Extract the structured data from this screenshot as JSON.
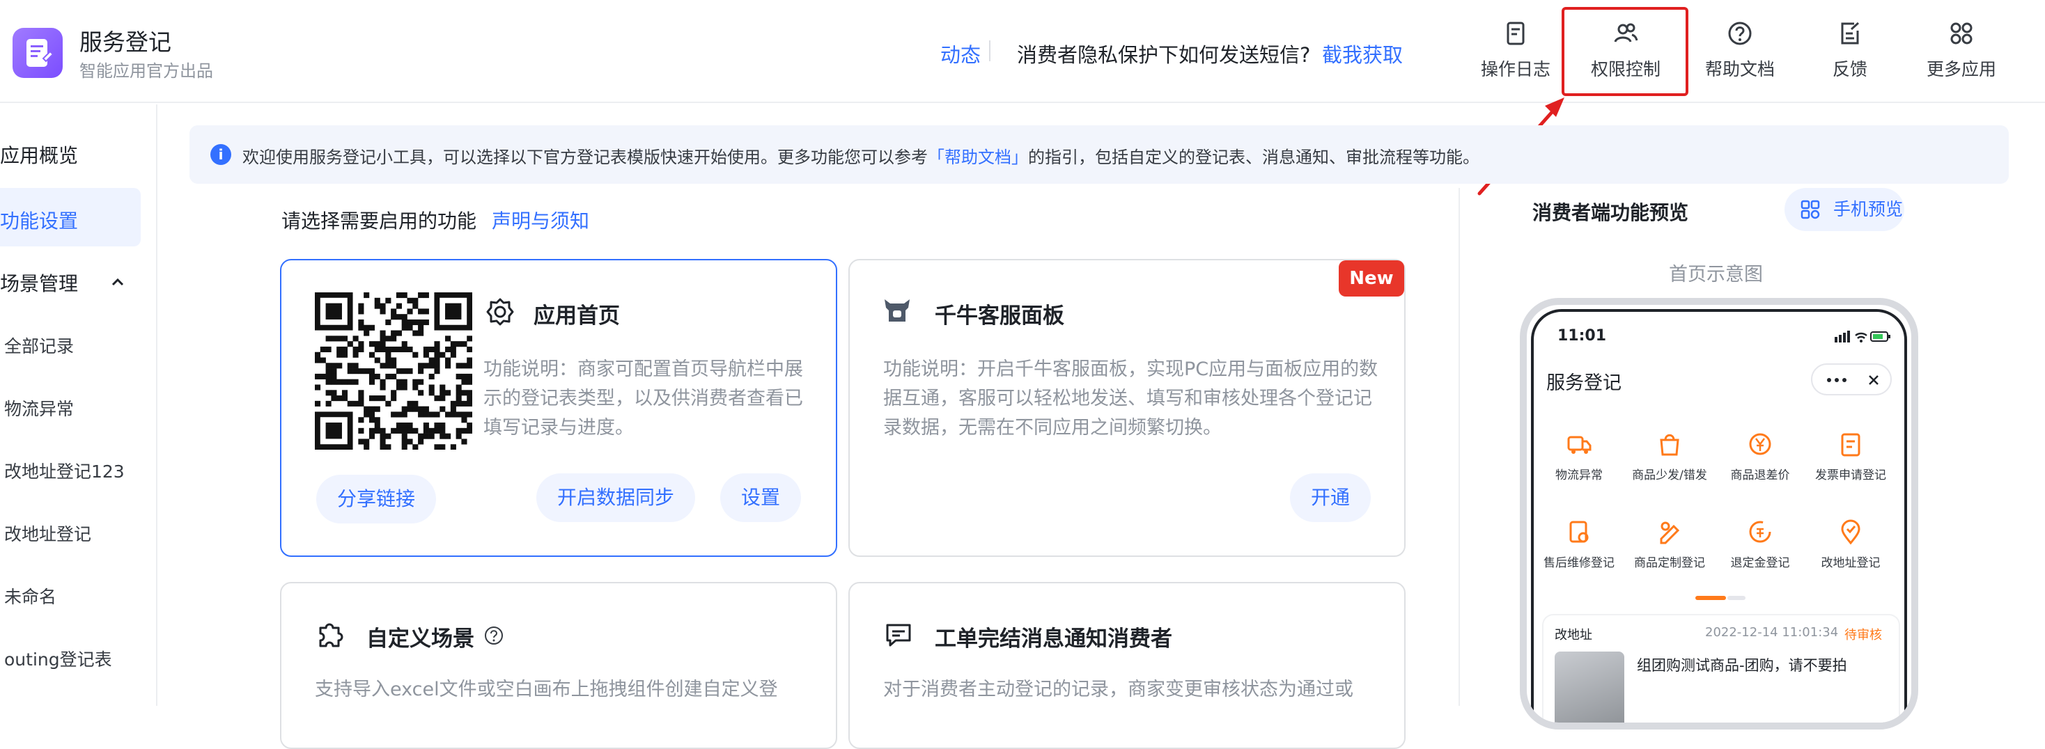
{
  "header": {
    "app_title": "服务登记",
    "app_subtitle": "智能应用官方出品",
    "nav_dongtai": "动态",
    "nav_question": "消费者隐私保护下如何发送短信?",
    "nav_capture": "截我获取",
    "buttons": [
      {
        "label": "操作日志",
        "icon": "log-icon"
      },
      {
        "label": "权限控制",
        "icon": "permission-icon"
      },
      {
        "label": "帮助文档",
        "icon": "help-icon"
      },
      {
        "label": "反馈",
        "icon": "feedback-icon"
      },
      {
        "label": "更多应用",
        "icon": "apps-icon"
      }
    ],
    "highlight_color": "#e02020"
  },
  "sidebar": {
    "items": [
      {
        "label": "应用概览"
      },
      {
        "label": "功能设置",
        "active": true
      },
      {
        "label": "场景管理"
      }
    ],
    "sub_items": [
      "全部记录",
      "物流异常",
      "改地址登记123",
      "改地址登记",
      "未命名",
      "outing登记表"
    ]
  },
  "notice": {
    "prefix": "欢迎使用服务登记小工具，可以选择以下官方登记表模版快速开始使用。更多功能您可以参考",
    "link": "「帮助文档」",
    "suffix": "的指引，包括自定义的登记表、消息通知、审批流程等功能。"
  },
  "main": {
    "select_label": "请选择需要启用的功能",
    "statement_link": "声明与须知",
    "cards": [
      {
        "title": "应用首页",
        "desc": "功能说明：商家可配置首页导航栏中展示的登记表类型，以及供消费者查看已填写记录与进度。",
        "buttons": [
          "分享链接",
          "开启数据同步",
          "设置"
        ]
      },
      {
        "title": "千牛客服面板",
        "badge": "New",
        "desc": "功能说明：开启千牛客服面板，实现PC应用与面板应用的数据互通，客服可以轻松地发送、填写和审核处理各个登记记录数据，无需在不同应用之间频繁切换。",
        "buttons": [
          "开通"
        ]
      },
      {
        "title": "自定义场景",
        "desc": "支持导入excel文件或空白画布上拖拽组件创建自定义登"
      },
      {
        "title": "工单完结消息通知消费者",
        "desc": "对于消费者主动登记的记录，商家变更审核状态为通过或"
      }
    ]
  },
  "preview": {
    "title": "消费者端功能预览",
    "phone_button": "手机预览",
    "diagram_label": "首页示意图",
    "phone": {
      "time": "11:01",
      "app_title": "服务登记",
      "grid": [
        "物流异常",
        "商品少发/错发",
        "商品退差价",
        "发票申请登记",
        "售后维修登记",
        "商品定制登记",
        "退定金登记",
        "改地址登记"
      ],
      "record": {
        "type": "改地址",
        "time": "2022-12-14 11:01:34",
        "status": "待审核",
        "text": "组团购测试商品-团购，请不要拍"
      }
    }
  }
}
